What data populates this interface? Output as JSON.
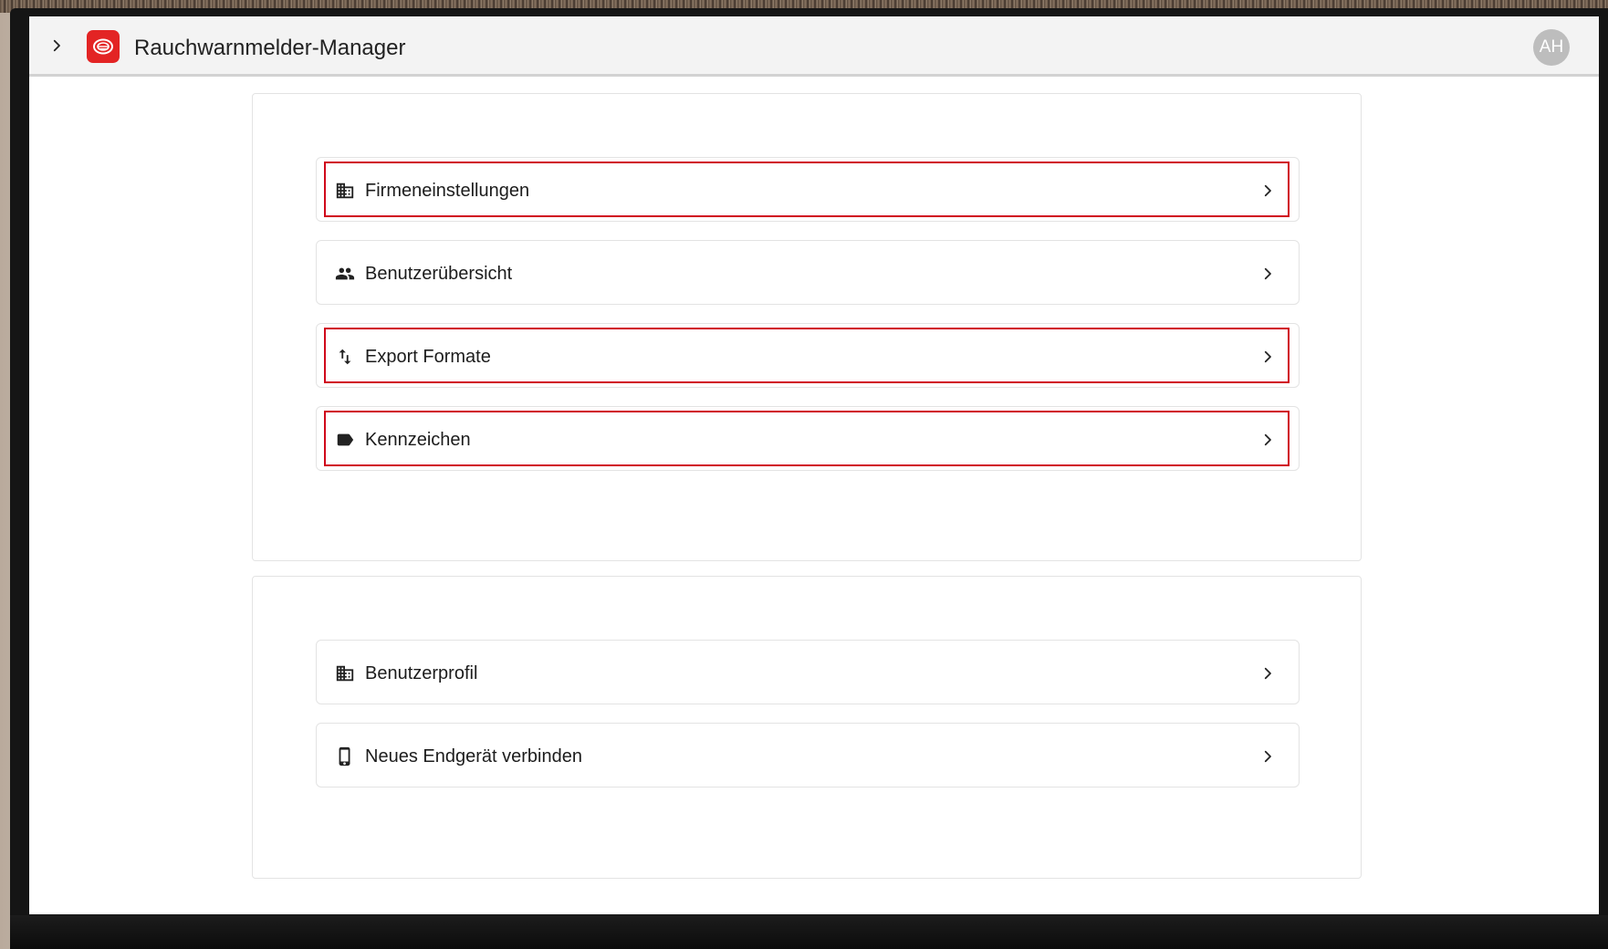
{
  "app": {
    "title": "Rauchwarnmelder-Manager",
    "avatar_initials": "AH",
    "brand_color": "#e32424",
    "highlight_color": "#d0021b"
  },
  "company_settings_card": {
    "items": [
      {
        "label": "Firmeneinstellungen",
        "icon": "business-building-icon",
        "highlighted": true
      },
      {
        "label": "Benutzerübersicht",
        "icon": "people-icon",
        "highlighted": false
      },
      {
        "label": "Export Formate",
        "icon": "import-export-arrows-icon",
        "highlighted": true
      },
      {
        "label": "Kennzeichen",
        "icon": "label-tag-icon",
        "highlighted": true
      }
    ]
  },
  "user_settings_card": {
    "items": [
      {
        "label": "Benutzerprofil",
        "icon": "business-building-icon",
        "highlighted": false
      },
      {
        "label": "Neues Endgerät verbinden",
        "icon": "smartphone-icon",
        "highlighted": false
      }
    ]
  }
}
